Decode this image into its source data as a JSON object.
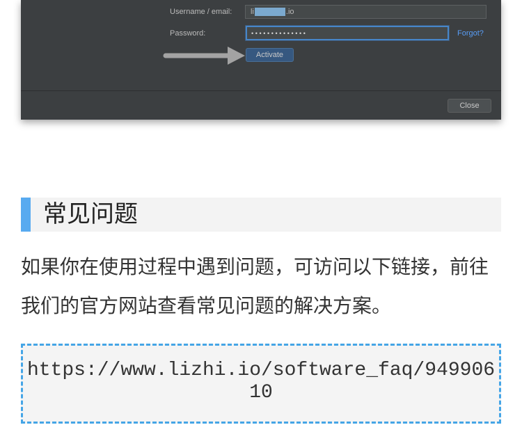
{
  "dialog": {
    "username_label": "Username / email:",
    "username_value_prefix": "li",
    "username_value_suffix": ".io",
    "password_label": "Password:",
    "password_mask": "••••••••••••••",
    "forgot_link": "Forgot?",
    "activate_button": "Activate",
    "close_button": "Close"
  },
  "section": {
    "heading": "常见问题",
    "paragraph": "如果你在使用过程中遇到问题，可访问以下链接，前往我们的官方网站查看常见问题的解决方案。",
    "code_url": "https://www.lizhi.io/software_faq/94990610"
  },
  "icons": {
    "pointer_arrow": "arrow-right-icon"
  },
  "colors": {
    "dialog_background": "#3c3f41",
    "activate_button": "#365880",
    "link": "#589df6",
    "focus_border": "#4786c9",
    "heading_accent": "#58aaf0",
    "code_border": "#45a5e6"
  }
}
